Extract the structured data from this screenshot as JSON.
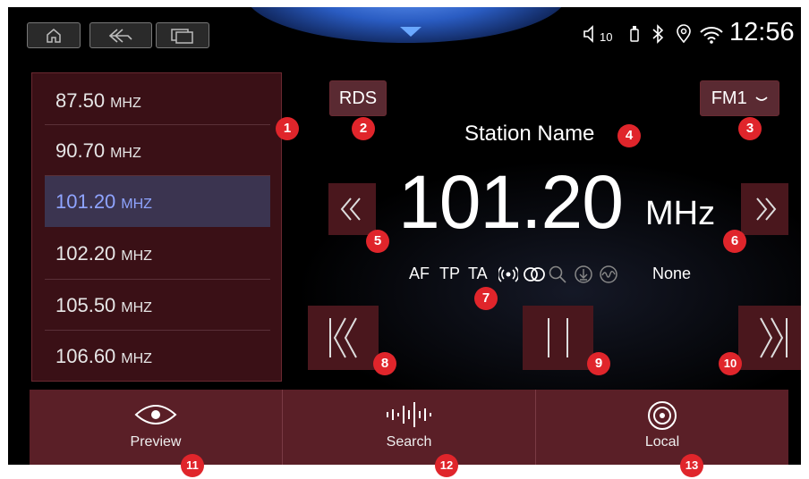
{
  "header": {
    "nav": [
      "home-icon",
      "back-icon",
      "recent-apps-icon"
    ],
    "volume_level": "10",
    "clock": "12:56",
    "status_icons": [
      "volume-icon",
      "usb-icon",
      "bluetooth-icon",
      "location-icon",
      "wifi-icon"
    ]
  },
  "stations": [
    {
      "freq": "87.50",
      "unit": "MHZ"
    },
    {
      "freq": "90.70",
      "unit": "MHZ"
    },
    {
      "freq": "101.20",
      "unit": "MHZ"
    },
    {
      "freq": "102.20",
      "unit": "MHZ"
    },
    {
      "freq": "105.50",
      "unit": "MHZ"
    },
    {
      "freq": "106.60",
      "unit": "MHZ"
    }
  ],
  "selected_station_index": 2,
  "main": {
    "rds_label": "RDS",
    "band_label": "FM1",
    "station_name": "Station Name",
    "frequency": "101.20",
    "frequency_unit": "MHz",
    "indicators": {
      "af": "AF",
      "tp": "TP",
      "ta": "TA",
      "pty": "None"
    }
  },
  "bottom_tabs": [
    {
      "label": "Preview",
      "icon": "eye-icon"
    },
    {
      "label": "Search",
      "icon": "waveform-icon"
    },
    {
      "label": "Local",
      "icon": "broadcast-icon"
    }
  ],
  "callouts": [
    "1",
    "2",
    "3",
    "4",
    "5",
    "6",
    "7",
    "8",
    "9",
    "10",
    "11",
    "12",
    "13"
  ],
  "colors": {
    "accent_red": "#e0252b",
    "selected_text": "#8fa4ff",
    "panel": "#4a171d"
  }
}
